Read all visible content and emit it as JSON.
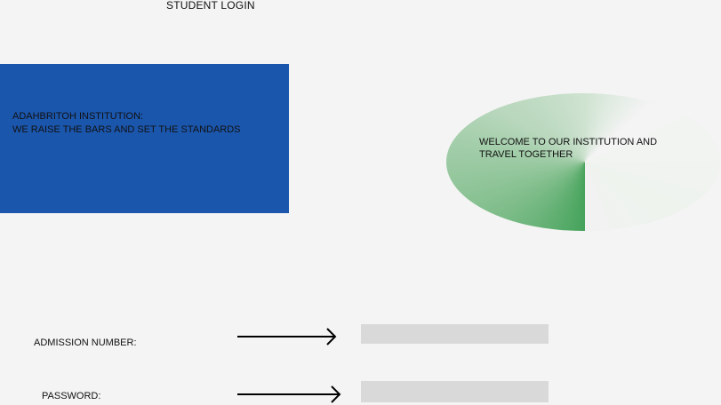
{
  "header": {
    "title": "STUDENT LOGIN"
  },
  "banner": {
    "line1": "ADAHBRITOH INSTITUTION:",
    "line2": "WE RAISE  THE BARS AND SET THE STANDARDS",
    "color": "#1b56ad"
  },
  "welcome": {
    "text": "WELCOME TO OUR INSTITUTION AND TRAVEL TOGETHER",
    "accent": "#45a35b"
  },
  "form": {
    "admission": {
      "label": "ADMISSION  NUMBER:",
      "value": "",
      "placeholder": ""
    },
    "password": {
      "label": "PASSWORD:",
      "value": "",
      "placeholder": ""
    },
    "arrow_icon": "right-arrow-icon",
    "field_color": "#d9d9d9"
  }
}
